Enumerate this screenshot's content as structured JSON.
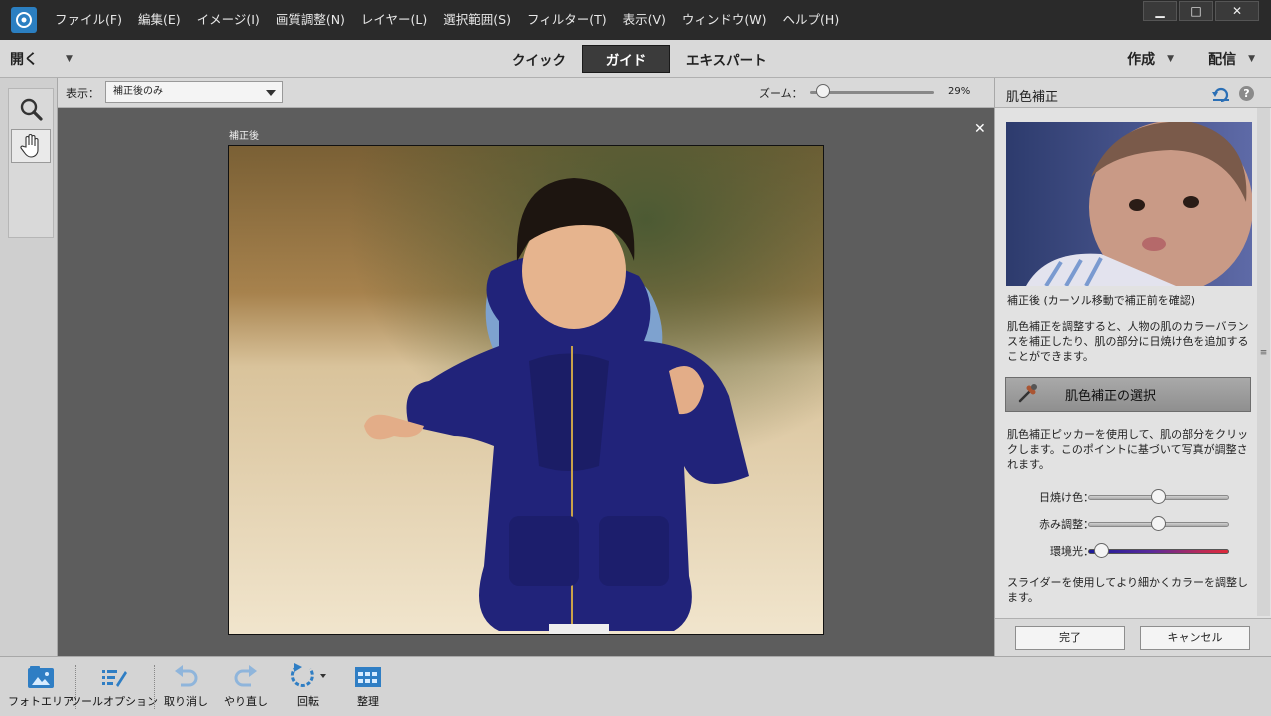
{
  "menu": {
    "items": [
      "ファイル(F)",
      "編集(E)",
      "イメージ(I)",
      "画質調整(N)",
      "レイヤー(L)",
      "選択範囲(S)",
      "フィルター(T)",
      "表示(V)",
      "ウィンドウ(W)",
      "ヘルプ(H)"
    ]
  },
  "window_controls": {
    "minimize": "▁",
    "maximize": "□",
    "close": "✕"
  },
  "modebar": {
    "open": "開く",
    "tabs": [
      "クイック",
      "ガイド",
      "エキスパート"
    ],
    "active_tab": "ガイド",
    "create": "作成",
    "share": "配信"
  },
  "viewbar": {
    "view_label": "表示：",
    "view_value": "補正後のみ",
    "zoom_label": "ズーム：",
    "zoom_value": "29%",
    "zoom_fraction": 0.05
  },
  "canvas": {
    "caption": "補正後",
    "close": "✕"
  },
  "panel": {
    "title": "肌色補正",
    "preview_caption": "補正後 (カーソル移動で補正前を確認)",
    "description": "肌色補正を調整すると、人物の肌のカラーバランスを補正したり、肌の部分に日焼け色を追加することができます。",
    "picker_button": "肌色補正の選択",
    "picker_description": "肌色補正ピッカーを使用して、肌の部分をクリックします。このポイントに基づいて写真が調整されます。",
    "sliders": [
      {
        "label": "日焼け色：",
        "value": 0.5
      },
      {
        "label": "赤み調整：",
        "value": 0.5
      },
      {
        "label": "環境光：",
        "value": 0.05
      }
    ],
    "slider_note": "スライダーを使用してより細かくカラーを調整します。",
    "done": "完了",
    "cancel": "キャンセル"
  },
  "bottombar": {
    "items": [
      {
        "label": "フォトエリア",
        "icon": "photo-bin-icon"
      },
      {
        "label": "ツールオプション",
        "icon": "tool-options-icon"
      },
      {
        "label": "取り消し",
        "icon": "undo-icon"
      },
      {
        "label": "やり直し",
        "icon": "redo-icon"
      },
      {
        "label": "回転",
        "icon": "rotate-icon"
      },
      {
        "label": "整理",
        "icon": "organizer-icon"
      }
    ]
  },
  "colors": {
    "accent_blue": "#2b7fc1",
    "menubar_bg": "#2a2a2a",
    "active_tab_bg": "#3b3b3b",
    "canvas_bg": "#5d5d5d"
  }
}
